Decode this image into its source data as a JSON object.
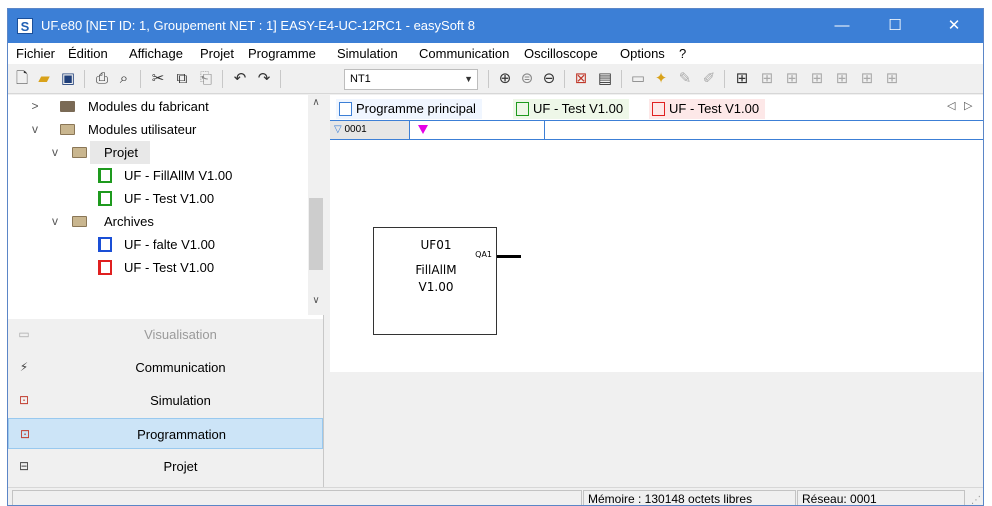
{
  "window": {
    "title": "UF.e80 [NET ID: 1, Groupement NET : 1] EASY-E4-UC-12RC1 - easySoft 8",
    "app_icon": "S",
    "controls": {
      "minimize": "—",
      "maximize": "☐",
      "close": "✕"
    }
  },
  "menu": [
    "Fichier",
    "Édition",
    "Affichage",
    "Projet",
    "Programme",
    "Simulation",
    "Communication",
    "Oscilloscope",
    "Options",
    "?"
  ],
  "toolbar": {
    "net_select_value": "NT1",
    "icons": [
      "new-file-icon",
      "open-folder-icon",
      "save-icon",
      "print-icon",
      "print-preview-icon",
      "cut-icon",
      "copy-icon",
      "paste-icon",
      "undo-icon",
      "redo-icon",
      "zoom-in-icon",
      "zoom-reset-icon",
      "zoom-out-icon",
      "delete-icon",
      "properties-icon"
    ]
  },
  "tree": {
    "items": [
      {
        "label": "Modules du fabricant",
        "expander": ">"
      },
      {
        "label": "Modules utilisateur",
        "expander": "v"
      },
      {
        "label": "Projet",
        "expander": "v"
      },
      {
        "label": "UF - FillAllM V1.00"
      },
      {
        "label": "UF - Test V1.00"
      },
      {
        "label": "Archives",
        "expander": "v"
      },
      {
        "label": "UF - falte V1.00"
      },
      {
        "label": "UF - Test V1.00"
      }
    ],
    "icon_colors": {
      "green": "#1e9a1e",
      "blue": "#1a4fd6",
      "red": "#e02020"
    }
  },
  "nav": [
    {
      "label": "Visualisation",
      "icon": "visualisation-icon"
    },
    {
      "label": "Communication",
      "icon": "communication-icon"
    },
    {
      "label": "Simulation",
      "icon": "simulation-icon"
    },
    {
      "label": "Programmation",
      "icon": "programmation-icon"
    },
    {
      "label": "Projet",
      "icon": "projet-icon"
    }
  ],
  "tabs": [
    {
      "label": "Programme principal",
      "bg": "#f0f6ff"
    },
    {
      "label": "UF - Test V1.00",
      "bg": "#eef7e8"
    },
    {
      "label": "UF - Test V1.00",
      "bg": "#fde8e8"
    }
  ],
  "tab_nav": {
    "prev": "◁",
    "next": "▷"
  },
  "network": {
    "id": "0001",
    "marker": "▽"
  },
  "block": {
    "name": "UF01",
    "type_line1": "FillAllM",
    "type_line2": "V1.00",
    "port": "QA1"
  },
  "status": {
    "memory": "Mémoire : 130148 octets libres",
    "network": "Réseau: 0001"
  },
  "colors": {
    "titlebar": "#3c7fd6",
    "accent": "#3c7fd6",
    "nav_active": "#cce4f7",
    "marker": "#e600e6"
  }
}
